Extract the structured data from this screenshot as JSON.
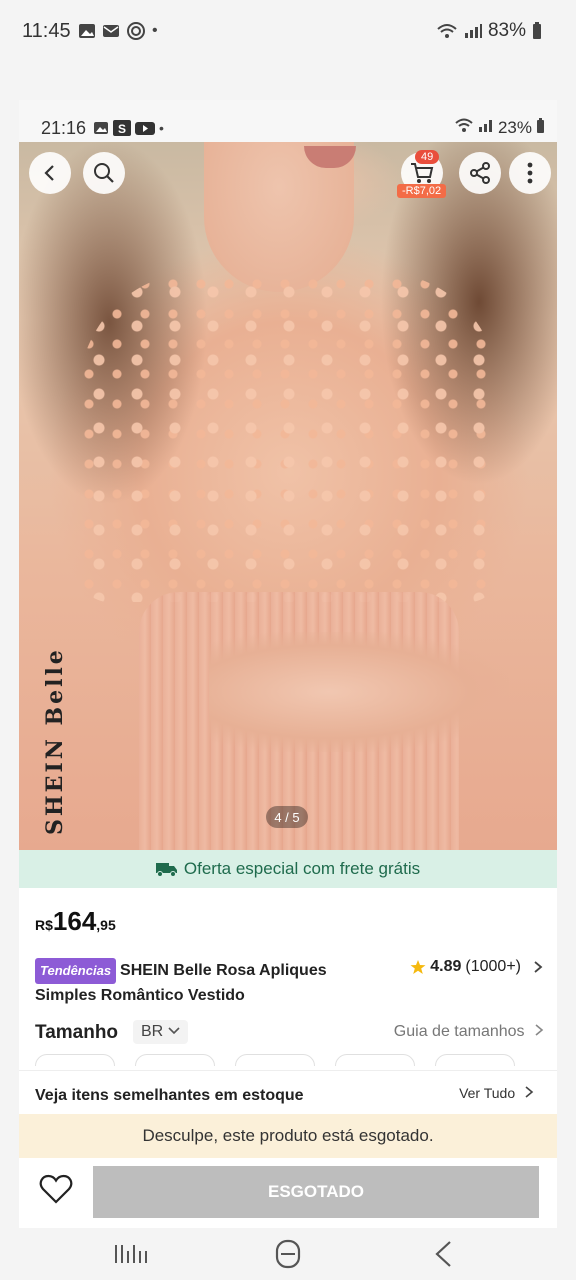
{
  "outer_status": {
    "time": "11:45",
    "battery": "83%"
  },
  "inner_status": {
    "time": "21:16",
    "battery": "23%"
  },
  "header": {
    "cart_count": "49",
    "cart_discount": "-R$7,02"
  },
  "gallery": {
    "brand": "SHEIN Belle",
    "pager": "4 / 5"
  },
  "shipping_banner": {
    "text": "Oferta especial com frete grátis"
  },
  "price": {
    "currency": "R$",
    "integer": "164",
    "decimal": ",95"
  },
  "product": {
    "trend_badge": "Tendências",
    "title": "SHEIN Belle Rosa Apliques Simples Romântico Vestido",
    "rating": "4.89",
    "review_count": "(1000+)"
  },
  "size": {
    "label": "Tamanho",
    "region": "BR",
    "guide": "Guia de tamanhos"
  },
  "similar": {
    "title": "Veja itens semelhantes em estoque",
    "view_all": "Ver Tudo"
  },
  "soldout_message": "Desculpe, este produto está esgotado.",
  "soldout_button": "ESGOTADO",
  "colors": {
    "accent": "#e94e3c",
    "banner_bg": "#d9f0e6",
    "banner_text": "#1f6b4d",
    "trend": "#8d5bd6",
    "soldout_bg": "#fbf0d9",
    "button_disabled": "#bdbdbd"
  }
}
